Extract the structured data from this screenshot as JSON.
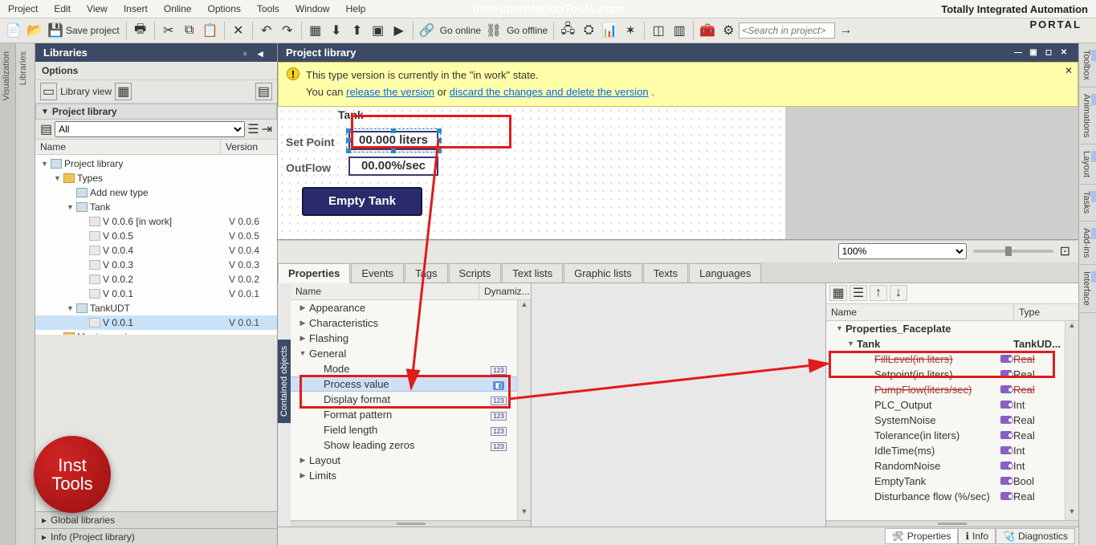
{
  "menubar": [
    "Project",
    "Edit",
    "View",
    "Insert",
    "Online",
    "Options",
    "Tools",
    "Window",
    "Help"
  ],
  "brand": "InstrumentationTools.com",
  "tagline": "Totally Integrated Automation",
  "portal": "PORTAL",
  "toolbar": {
    "save_label": "Save project",
    "go_online": "Go online",
    "go_offline": "Go offline",
    "search_ph": "<Search in project>"
  },
  "leftrail": {
    "label": "Visualization",
    "label2": "Libraries"
  },
  "libraries": {
    "panel_title": "Libraries",
    "options": "Options",
    "library_view": "Library view",
    "project_library": "Project library",
    "filter_all": "All",
    "cols": {
      "name": "Name",
      "version": "Version"
    },
    "tree": [
      {
        "label": "Project library",
        "indent": 0,
        "expanded": true,
        "icon": "type"
      },
      {
        "label": "Types",
        "indent": 1,
        "expanded": true,
        "icon": "folder"
      },
      {
        "label": "Add new type",
        "indent": 2,
        "icon": "add"
      },
      {
        "label": "Tank",
        "indent": 2,
        "expanded": true,
        "icon": "type"
      },
      {
        "label": "V 0.0.6 [in work]",
        "ver": "V 0.0.6",
        "indent": 3,
        "icon": "ver"
      },
      {
        "label": "V 0.0.5",
        "ver": "V 0.0.5",
        "indent": 3,
        "icon": "ver"
      },
      {
        "label": "V 0.0.4",
        "ver": "V 0.0.4",
        "indent": 3,
        "icon": "ver"
      },
      {
        "label": "V 0.0.3",
        "ver": "V 0.0.3",
        "indent": 3,
        "icon": "ver"
      },
      {
        "label": "V 0.0.2",
        "ver": "V 0.0.2",
        "indent": 3,
        "icon": "ver"
      },
      {
        "label": "V 0.0.1",
        "ver": "V 0.0.1",
        "indent": 3,
        "icon": "ver"
      },
      {
        "label": "TankUDT",
        "indent": 2,
        "expanded": true,
        "icon": "type"
      },
      {
        "label": "V 0.0.1",
        "ver": "V 0.0.1",
        "indent": 3,
        "icon": "ver",
        "selected": true
      },
      {
        "label": "Master copies",
        "indent": 1,
        "expanded": false,
        "icon": "folder"
      }
    ],
    "global": "Global libraries",
    "info": "Info (Project library)"
  },
  "main": {
    "title": "Project library",
    "warn": {
      "line1": "This type version is currently in the \"in work\" state.",
      "line2_pre": "You can ",
      "link1": "release the version",
      "mid": " or ",
      "link2": "discard the changes and delete the version",
      "post": " ."
    },
    "canvas": {
      "title": "Tank",
      "setpoint_lbl": "Set Point",
      "setpoint_val": "00.000 liters",
      "outflow_lbl": "OutFlow",
      "outflow_val": "00.00%/sec",
      "button": "Empty Tank"
    },
    "zoom": "100%"
  },
  "prop_tabs": [
    "Properties",
    "Events",
    "Tags",
    "Scripts",
    "Text lists",
    "Graphic lists",
    "Texts",
    "Languages"
  ],
  "props": {
    "cols": {
      "name": "Name",
      "dyn": "Dynamiz..."
    },
    "rows": [
      {
        "label": "Appearance",
        "exp": "▶",
        "indent": 0
      },
      {
        "label": "Characteristics",
        "exp": "▶",
        "indent": 0
      },
      {
        "label": "Flashing",
        "exp": "▶",
        "indent": 0
      },
      {
        "label": "General",
        "exp": "▼",
        "indent": 0
      },
      {
        "label": "Mode",
        "indent": 1,
        "dyn": "123"
      },
      {
        "label": "Process value",
        "indent": 1,
        "dyn": "tag",
        "selected": true
      },
      {
        "label": "Display format",
        "indent": 1,
        "dyn": "123"
      },
      {
        "label": "Format pattern",
        "indent": 1,
        "dyn": "123"
      },
      {
        "label": "Field length",
        "indent": 1,
        "dyn": "123"
      },
      {
        "label": "Show leading zeros",
        "indent": 1,
        "dyn": "123"
      },
      {
        "label": "Layout",
        "exp": "▶",
        "indent": 0
      },
      {
        "label": "Limits",
        "exp": "▶",
        "indent": 0
      }
    ],
    "contained": "Contained objects"
  },
  "iface": {
    "cols": {
      "name": "Name",
      "type": "Type"
    },
    "rows": [
      {
        "name": "Properties_Faceplate",
        "indent": 0,
        "exp": "▼",
        "group": true
      },
      {
        "name": "Tank",
        "type": "TankUD...",
        "indent": 1,
        "exp": "▼",
        "group": true
      },
      {
        "name": "FillLevel(in liters)",
        "type": "Real",
        "indent": 2,
        "tag": true,
        "struck": true
      },
      {
        "name": "Setpoint(in liters)",
        "type": "Real",
        "indent": 2,
        "tag": true
      },
      {
        "name": "PumpFlow(liters/sec)",
        "type": "Real",
        "indent": 2,
        "tag": true,
        "struck": true
      },
      {
        "name": "PLC_Output",
        "type": "Int",
        "indent": 2,
        "tag": true
      },
      {
        "name": "SystemNoise",
        "type": "Real",
        "indent": 2,
        "tag": true
      },
      {
        "name": "Tolerance(in liters)",
        "type": "Real",
        "indent": 2,
        "tag": true
      },
      {
        "name": "IdleTime(ms)",
        "type": "Int",
        "indent": 2,
        "tag": true
      },
      {
        "name": "RandomNoise",
        "type": "Int",
        "indent": 2,
        "tag": true
      },
      {
        "name": "EmptyTank",
        "type": "Bool",
        "indent": 2,
        "tag": true
      },
      {
        "name": "Disturbance flow (%/sec)",
        "type": "Real",
        "indent": 2,
        "tag": true
      }
    ]
  },
  "bottom_tabs": [
    {
      "label": "Properties",
      "icon": "cfg"
    },
    {
      "label": "Info",
      "icon": "info"
    },
    {
      "label": "Diagnostics",
      "icon": "diag"
    }
  ],
  "right_rail": [
    "Toolbox",
    "Animations",
    "Layout",
    "Tasks",
    "Add-ins",
    "Interface"
  ],
  "logo": "Inst\nTools"
}
